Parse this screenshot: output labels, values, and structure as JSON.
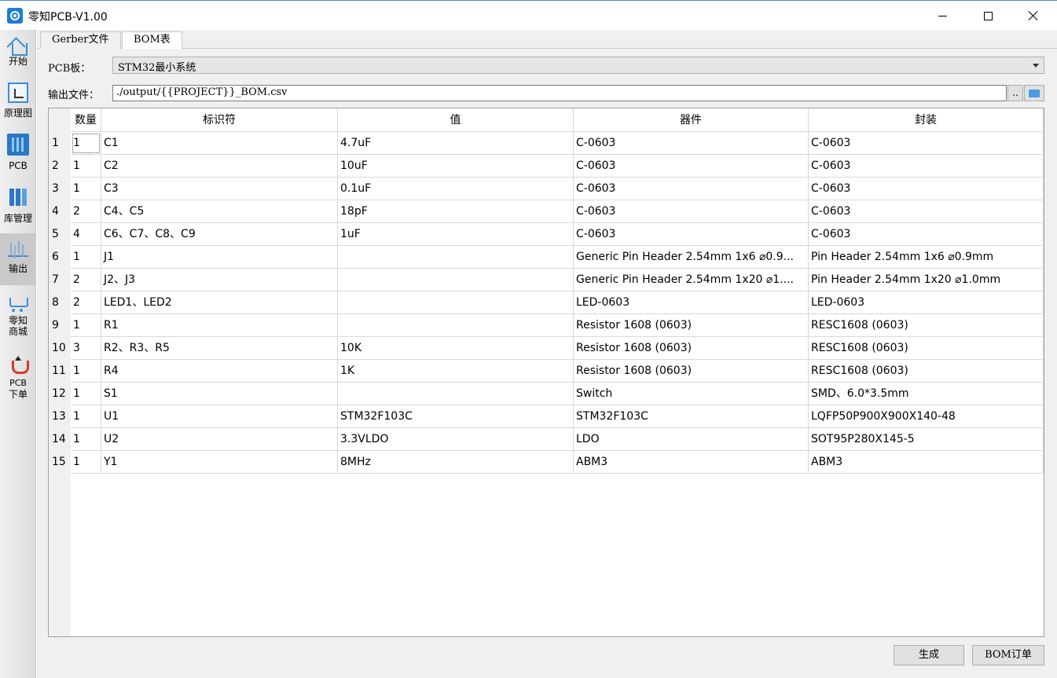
{
  "window": {
    "title": "零知PCB-V1.00"
  },
  "sidebar": {
    "items": [
      {
        "label": "开始",
        "icon": "home-icon"
      },
      {
        "label": "原理图",
        "icon": "schematic-icon"
      },
      {
        "label": "PCB",
        "icon": "pcb-board-icon"
      },
      {
        "label": "库管理",
        "icon": "library-icon"
      },
      {
        "label": "输出",
        "icon": "output-chart-icon"
      },
      {
        "label": "零知",
        "label2": "商城",
        "icon": "shopping-cart-icon"
      },
      {
        "label": "PCB",
        "label2": "下单",
        "icon": "pcb-order-icon"
      }
    ]
  },
  "tabs": [
    {
      "label": "Gerber文件"
    },
    {
      "label": "BOM表"
    }
  ],
  "form": {
    "pcb_label": "PCB板：",
    "pcb_value": "STM32最小系统",
    "output_label": "输出文件：",
    "output_value": "./output/{{PROJECT}}_BOM.csv",
    "browse_label": ".."
  },
  "table": {
    "headers": [
      "数量",
      "标识符",
      "值",
      "器件",
      "封装"
    ],
    "rows": [
      {
        "n": "1",
        "qty": "1",
        "ref": "C1",
        "val": "4.7uF",
        "part": "C-0603",
        "pkg": "C-0603"
      },
      {
        "n": "2",
        "qty": "1",
        "ref": "C2",
        "val": "10uF",
        "part": "C-0603",
        "pkg": "C-0603"
      },
      {
        "n": "3",
        "qty": "1",
        "ref": "C3",
        "val": "0.1uF",
        "part": "C-0603",
        "pkg": "C-0603"
      },
      {
        "n": "4",
        "qty": "2",
        "ref": "C4、C5",
        "val": "18pF",
        "part": "C-0603",
        "pkg": "C-0603"
      },
      {
        "n": "5",
        "qty": "4",
        "ref": "C6、C7、C8、C9",
        "val": "1uF",
        "part": "C-0603",
        "pkg": "C-0603"
      },
      {
        "n": "6",
        "qty": "1",
        "ref": "J1",
        "val": "",
        "part": "Generic Pin Header 2.54mm 1x6 ⌀0.9...",
        "pkg": "Pin Header 2.54mm 1x6 ⌀0.9mm"
      },
      {
        "n": "7",
        "qty": "2",
        "ref": "J2、J3",
        "val": "",
        "part": "Generic Pin Header 2.54mm 1x20 ⌀1....",
        "pkg": "Pin Header 2.54mm 1x20 ⌀1.0mm"
      },
      {
        "n": "8",
        "qty": "2",
        "ref": "LED1、LED2",
        "val": "",
        "part": "LED-0603",
        "pkg": "LED-0603"
      },
      {
        "n": "9",
        "qty": "1",
        "ref": "R1",
        "val": "",
        "part": "Resistor 1608 (0603)",
        "pkg": "RESC1608 (0603)"
      },
      {
        "n": "10",
        "qty": "3",
        "ref": "R2、R3、R5",
        "val": "10K",
        "part": "Resistor 1608 (0603)",
        "pkg": "RESC1608 (0603)"
      },
      {
        "n": "11",
        "qty": "1",
        "ref": "R4",
        "val": "1K",
        "part": "Resistor 1608 (0603)",
        "pkg": "RESC1608 (0603)"
      },
      {
        "n": "12",
        "qty": "1",
        "ref": "S1",
        "val": "",
        "part": "Switch",
        "pkg": "SMD、6.0*3.5mm"
      },
      {
        "n": "13",
        "qty": "1",
        "ref": "U1",
        "val": "STM32F103C",
        "part": "STM32F103C",
        "pkg": "LQFP50P900X900X140-48"
      },
      {
        "n": "14",
        "qty": "1",
        "ref": "U2",
        "val": "3.3VLDO",
        "part": "LDO",
        "pkg": "SOT95P280X145-5"
      },
      {
        "n": "15",
        "qty": "1",
        "ref": "Y1",
        "val": "8MHz",
        "part": "ABM3",
        "pkg": "ABM3"
      }
    ]
  },
  "buttons": {
    "generate": "生成",
    "bom_order": "BOM订单"
  }
}
